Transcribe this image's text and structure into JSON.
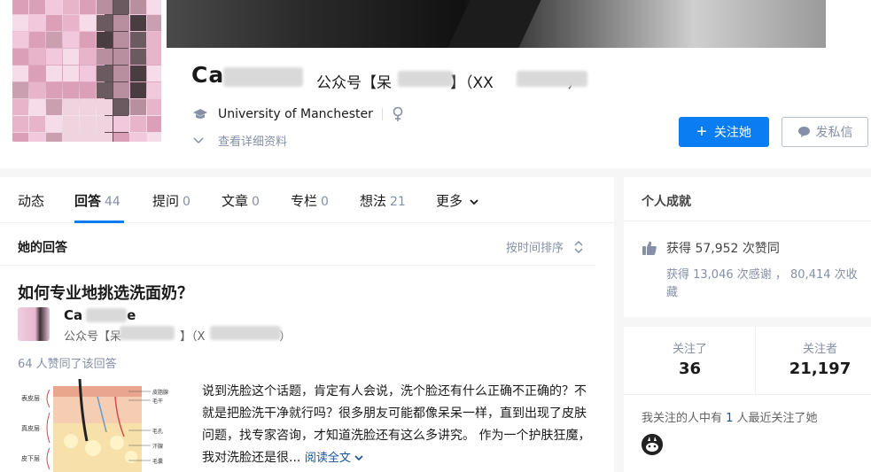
{
  "profile": {
    "name_visible": "Ca",
    "name_tail": "",
    "headline_prefix": "公众号【呆",
    "headline_mid": "】（XX",
    "headline_suffix": "）",
    "school": "University of Manchester",
    "gender_icon": "female-icon",
    "detail_link": "查看详细资料",
    "follow_label": "关注她",
    "message_label": "发私信"
  },
  "tabs": [
    {
      "label": "动态",
      "count": ""
    },
    {
      "label": "回答",
      "count": "44"
    },
    {
      "label": "提问",
      "count": "0"
    },
    {
      "label": "文章",
      "count": "0"
    },
    {
      "label": "专栏",
      "count": "0"
    },
    {
      "label": "想法",
      "count": "21"
    },
    {
      "label": "更多",
      "count": ""
    }
  ],
  "answers": {
    "section_title": "她的回答",
    "sort_label": "按时间排序",
    "question": "如何专业地挑选洗面奶？",
    "author_name_prefix": "Ca",
    "author_name_suffix": "e",
    "author_headline_prefix": "公众号【呆",
    "author_headline_mid": "】（X",
    "author_headline_suffix": "）",
    "votes": "64 人赞同了该回答",
    "excerpt": "说到洗脸这个话题，肯定有人会说，洗个脸还有什么正确不正确的？不就是把脸洗干净就行吗？很多朋友可能都像呆呆一样，直到出现了皮肤问题，找专家咨询，才知道洗脸还有这么多讲究。 作为一个护肤狂魔，我对洗脸还是很...",
    "read_more": "阅读全文",
    "thumb_labels": [
      "表皮层",
      "真皮层",
      "皮下层",
      "毛干",
      "毛孔",
      "皮脂腺",
      "汗腺",
      "毛囊"
    ]
  },
  "sidebar": {
    "achievements_title": "个人成就",
    "likes": "获得 57,952 次赞同",
    "thanks": "获得 13,046 次感谢 ， 80,414 次收藏",
    "following_label": "关注了",
    "following_count": "36",
    "followers_label": "关注者",
    "followers_count": "21,197",
    "mutual_prefix": "我关注的人中有 ",
    "mutual_count": "1",
    "mutual_suffix": " 人最近关注了她"
  },
  "colors": {
    "accent": "#0a7df2",
    "link": "#175199",
    "muted": "#8590a6"
  }
}
